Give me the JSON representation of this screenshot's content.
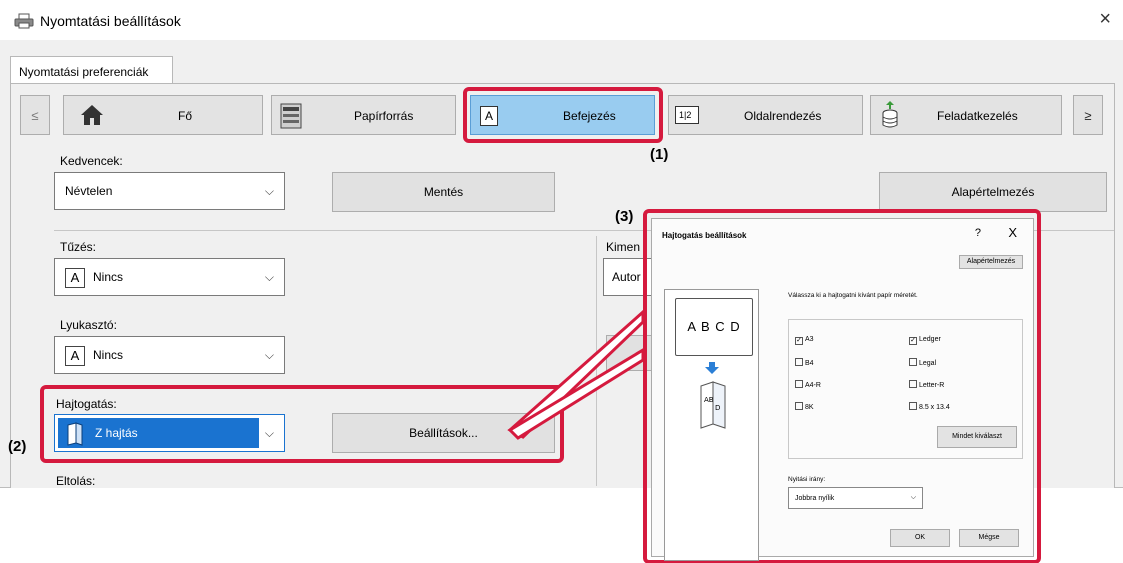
{
  "window": {
    "title": "Nyomtatási beállítások",
    "close": "×"
  },
  "tab": {
    "label": "Nyomtatási preferenciák"
  },
  "nav": {
    "prev": "≤",
    "next": "≥",
    "items": [
      {
        "label": "Fő"
      },
      {
        "label": "Papírforrás"
      },
      {
        "label": "Befejezés"
      },
      {
        "label": "Oldalrendezés"
      },
      {
        "label": "Feladatkezelés"
      }
    ]
  },
  "favorites": {
    "label": "Kedvencek:",
    "value": "Névtelen",
    "save": "Mentés",
    "defaults": "Alapértelmezés"
  },
  "staple": {
    "label": "Tűzés:",
    "value": "Nincs"
  },
  "punch": {
    "label": "Lyukasztó:",
    "value": "Nincs"
  },
  "output": {
    "label": "Kimen",
    "value": "Autor"
  },
  "fold": {
    "label": "Hajtogatás:",
    "value": "Z hajtás",
    "settings": "Beállítások..."
  },
  "offset": {
    "label": "Eltolás:"
  },
  "callouts": {
    "one": "(1)",
    "two": "(2)",
    "three": "(3)"
  },
  "dialog": {
    "title": "Hajtogatás beállítások",
    "help": "?",
    "close": "X",
    "defaults": "Alapértelmezés",
    "instruction": "Válassza ki a hajtogatni kívánt papír méretét.",
    "preview_text": "A B C D",
    "sizes_left": [
      "A3",
      "B4",
      "A4-R",
      "8K"
    ],
    "sizes_right": [
      "Ledger",
      "Legal",
      "Letter-R",
      "8.5 x 13.4"
    ],
    "checked": [
      "A3",
      "Ledger"
    ],
    "select_all": "Mindet kiválaszt",
    "direction_label": "Nyitási irány:",
    "direction_value": "Jobbra nyílik",
    "ok": "OK",
    "cancel": "Mégse"
  },
  "colors": {
    "accent_red": "#d51a3e",
    "selected_blue": "#1a73d0",
    "tab_highlight": "#99ccf0"
  }
}
